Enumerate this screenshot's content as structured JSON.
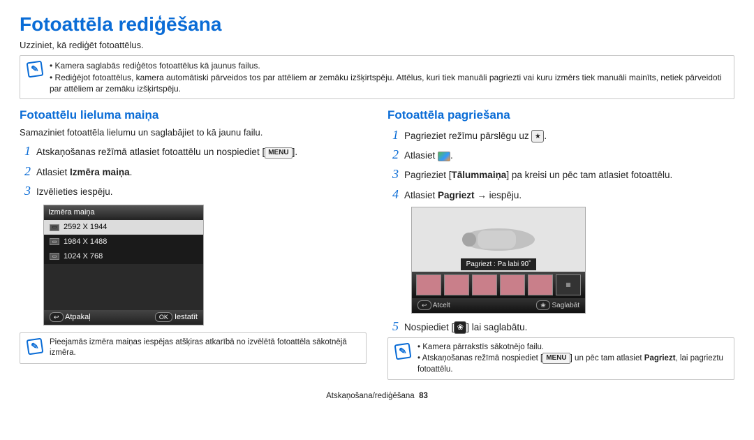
{
  "title": "Fotoattēla rediģēšana",
  "subtitle": "Uzziniet, kā rediģēt fotoattēlus.",
  "top_note": {
    "items": [
      "Kamera saglabās rediģētos fotoattēlus kā jaunus failus.",
      "Rediģējot fotoattēlus, kamera automātiski pārveidos tos par attēliem ar zemāku izšķirtspēju. Attēlus, kuri tiek manuāli pagriezti vai kuru izmērs tiek manuāli mainīts, netiek pārveidoti par attēliem ar zemāku izšķirtspēju."
    ]
  },
  "left": {
    "heading": "Fotoattēlu lieluma maiņa",
    "desc": "Samaziniet fotoattēla lielumu un saglabājiet to kā jaunu failu.",
    "steps": {
      "s1a": "Atskaņošanas režīmā atlasiet fotoattēlu un nospiediet [",
      "s1b": "].",
      "s2a": "Atlasiet ",
      "s2b": "Izmēra maiņa",
      "s2c": ".",
      "s3": "Izvēlieties iespēju."
    },
    "menu_label": "MENU",
    "mock": {
      "title": "Izmēra maiņa",
      "rows": [
        "2592 X 1944",
        "1984 X 1488",
        "1024 X 768"
      ],
      "back": "Atpakaļ",
      "ok": "OK",
      "set": "Iestatīt"
    },
    "bottom_note": "Pieejamās izmēra maiņas iespējas atšķiras atkarībā no izvēlētā fotoattēla sākotnējā izmēra."
  },
  "right": {
    "heading": "Fotoattēla pagriešana",
    "steps": {
      "s1a": "Pagrieziet režīmu pārslēgu uz ",
      "s1b": ".",
      "s2a": "Atlasiet ",
      "s2b": ".",
      "s3a": "Pagrieziet [",
      "s3b": "Tālummaiņa",
      "s3c": "] pa kreisi un pēc tam atlasiet fotoattēlu.",
      "s4a": "Atlasiet ",
      "s4b": "Pagriezt",
      "s4c": " → iespēju.",
      "s5a": "Nospiediet [",
      "s5b": "] lai saglabātu."
    },
    "gear": "✿",
    "mock": {
      "tip": "Pagriezt : Pa labi 90˚",
      "cancel": "Atcelt",
      "save": "Saglabāt"
    },
    "bottom_note": {
      "items_a": "Kamera pārrakstīs sākotnējo failu.",
      "items_b1": "Atskaņošanas režīmā nospiediet [",
      "items_b2": "] un pēc tam atlasiet ",
      "items_b3": "Pagriezt",
      "items_b4": ", lai pagrieztu fotoattēlu."
    }
  },
  "footer": {
    "section": "Atskaņošana/rediģēšana",
    "page": "83"
  }
}
